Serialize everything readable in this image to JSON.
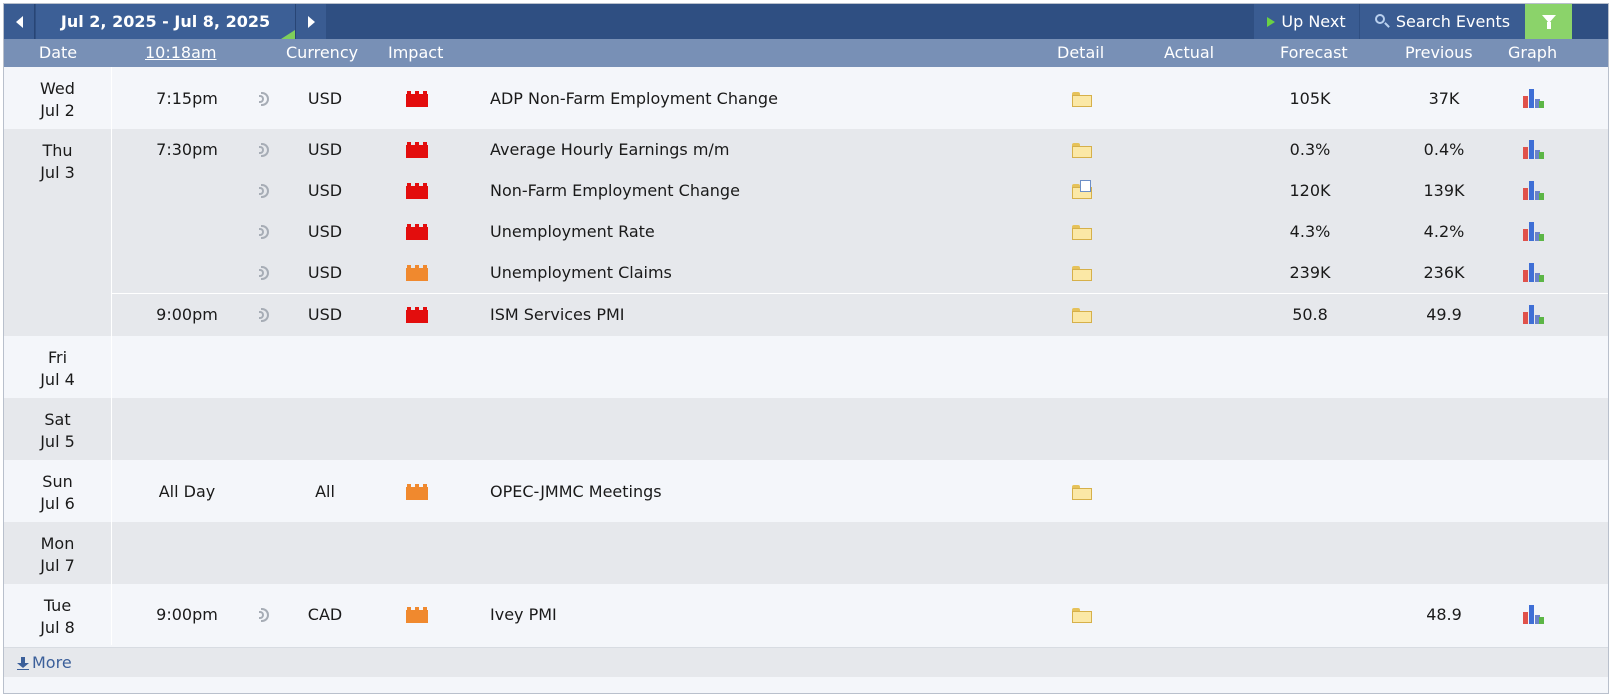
{
  "nav": {
    "range_label": "Jul 2, 2025 - Jul 8, 2025",
    "up_next_label": "Up Next",
    "search_label": "Search Events"
  },
  "columns": {
    "date": "Date",
    "time": "10:18am",
    "currency": "Currency",
    "impact": "Impact",
    "detail": "Detail",
    "actual": "Actual",
    "forecast": "Forecast",
    "previous": "Previous",
    "graph": "Graph"
  },
  "colors": {
    "high_impact": "#e30d0d",
    "medium_impact": "#f0892e",
    "header_bar": "#2f4f82",
    "column_bar": "#7890b6",
    "filter": "#8bd36a"
  },
  "days": [
    {
      "weekday": "Wed",
      "date": "Jul 2",
      "events": [
        {
          "time": "7:15pm",
          "currency": "USD",
          "impact": "high",
          "title": "ADP Non-Farm Employment Change",
          "detail_icon": "folder-icon",
          "actual": "",
          "forecast": "105K",
          "previous": "37K"
        }
      ]
    },
    {
      "weekday": "Thu",
      "date": "Jul 3",
      "events": [
        {
          "time": "7:30pm",
          "currency": "USD",
          "impact": "high",
          "title": "Average Hourly Earnings m/m",
          "detail_icon": "folder-icon",
          "actual": "",
          "forecast": "0.3%",
          "previous": "0.4%"
        },
        {
          "time": "",
          "currency": "USD",
          "impact": "high",
          "title": "Non-Farm Employment Change",
          "detail_icon": "folder-doc-icon",
          "actual": "",
          "forecast": "120K",
          "previous": "139K"
        },
        {
          "time": "",
          "currency": "USD",
          "impact": "high",
          "title": "Unemployment Rate",
          "detail_icon": "folder-icon",
          "actual": "",
          "forecast": "4.3%",
          "previous": "4.2%"
        },
        {
          "time": "",
          "currency": "USD",
          "impact": "medium",
          "title": "Unemployment Claims",
          "detail_icon": "folder-icon",
          "actual": "",
          "forecast": "239K",
          "previous": "236K"
        },
        {
          "time": "9:00pm",
          "currency": "USD",
          "impact": "high",
          "title": "ISM Services PMI",
          "detail_icon": "folder-icon",
          "actual": "",
          "forecast": "50.8",
          "previous": "49.9"
        }
      ]
    },
    {
      "weekday": "Fri",
      "date": "Jul 4",
      "events": []
    },
    {
      "weekday": "Sat",
      "date": "Jul 5",
      "events": []
    },
    {
      "weekday": "Sun",
      "date": "Jul 6",
      "events": [
        {
          "time": "All Day",
          "currency": "All",
          "impact": "medium",
          "title": "OPEC-JMMC Meetings",
          "detail_icon": "folder-icon",
          "actual": "",
          "forecast": "",
          "previous": ""
        }
      ]
    },
    {
      "weekday": "Mon",
      "date": "Jul 7",
      "events": []
    },
    {
      "weekday": "Tue",
      "date": "Jul 8",
      "events": [
        {
          "time": "9:00pm",
          "currency": "CAD",
          "impact": "medium",
          "title": "Ivey PMI",
          "detail_icon": "folder-icon",
          "actual": "",
          "forecast": "",
          "previous": "48.9"
        }
      ]
    }
  ],
  "footer": {
    "more_label": "More"
  }
}
